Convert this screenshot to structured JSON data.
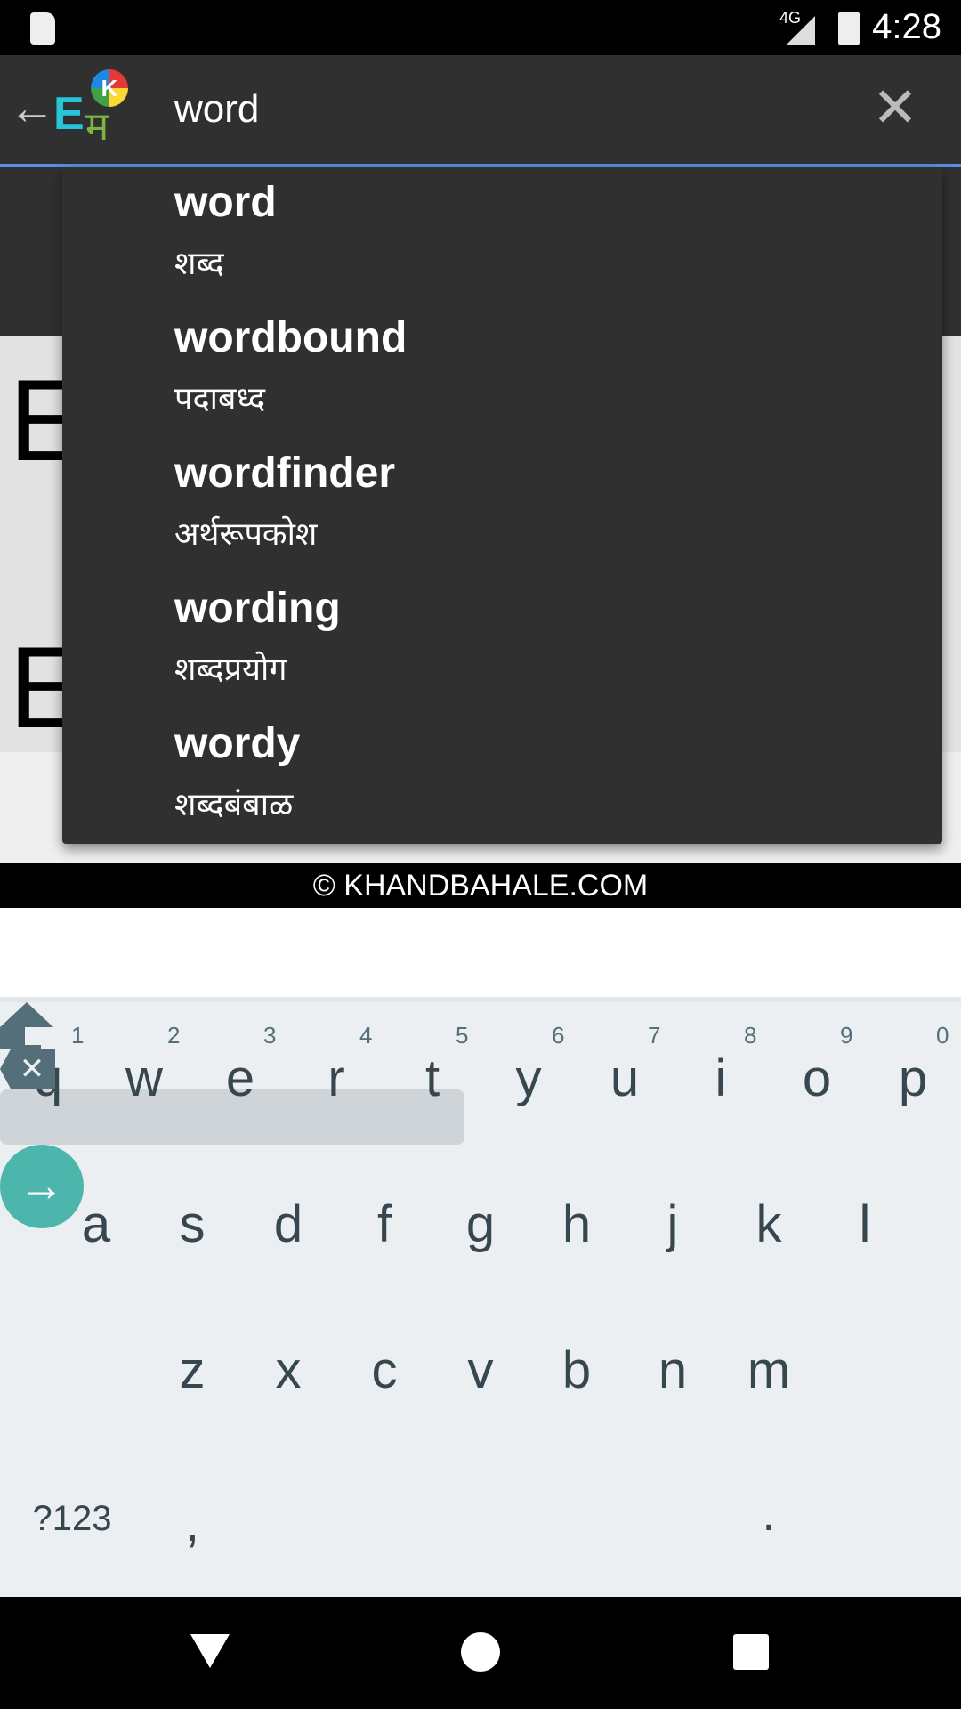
{
  "status_bar": {
    "time": "4:28",
    "network": "4G",
    "icons": [
      "sd-card-icon",
      "signal-icon",
      "battery-charging-icon"
    ]
  },
  "toolbar": {
    "search_value": "word",
    "icons": [
      "back-arrow-icon",
      "app-logo-icon",
      "clear-icon"
    ],
    "logo_letters": {
      "english": "E",
      "marathi": "म",
      "badge": "K"
    }
  },
  "suggestions": [
    {
      "word": "word",
      "meaning": "शब्द"
    },
    {
      "word": "wordbound",
      "meaning": "पदाबध्द"
    },
    {
      "word": "wordfinder",
      "meaning": "अर्थरूपकोश"
    },
    {
      "word": "wording",
      "meaning": "शब्दप्रयोग"
    },
    {
      "word": "wordy",
      "meaning": "शब्दबंबाळ"
    }
  ],
  "background": {
    "letter1": "E",
    "letter2": "E"
  },
  "footer": {
    "text": "© KHANDBAHALE.COM"
  },
  "keyboard": {
    "row1": [
      "q",
      "w",
      "e",
      "r",
      "t",
      "y",
      "u",
      "i",
      "o",
      "p"
    ],
    "hints": [
      "1",
      "2",
      "3",
      "4",
      "5",
      "6",
      "7",
      "8",
      "9",
      "0"
    ],
    "row2": [
      "a",
      "s",
      "d",
      "f",
      "g",
      "h",
      "j",
      "k",
      "l"
    ],
    "row3": [
      "z",
      "x",
      "c",
      "v",
      "b",
      "n",
      "m"
    ],
    "symbols_label": "?123",
    "comma": ",",
    "period": ".",
    "enter_color": "#4db6ac"
  }
}
